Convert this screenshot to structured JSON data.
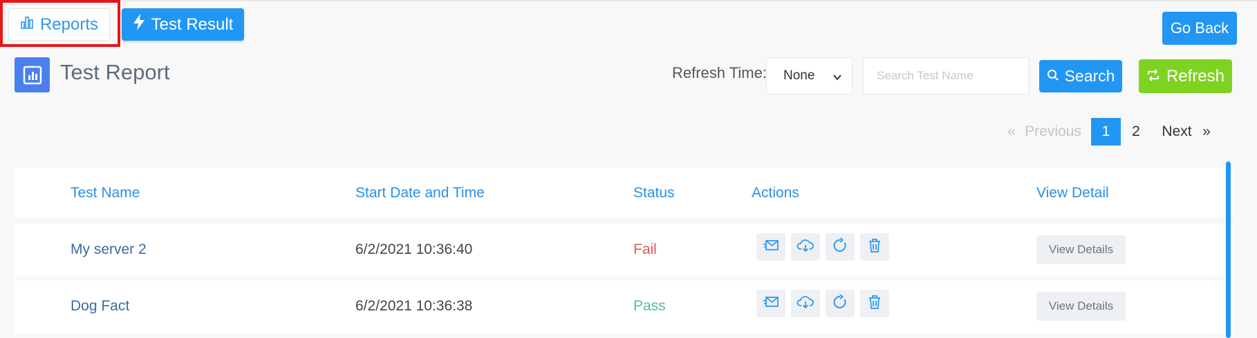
{
  "tabs": [
    {
      "label": "Reports",
      "icon": "bar-chart-icon"
    },
    {
      "label": "Test Result",
      "icon": "lightning-icon"
    }
  ],
  "header": {
    "go_back_label": "Go Back",
    "title": "Test Report",
    "title_icon": "report-chart-icon"
  },
  "toolbar": {
    "refresh_time_label": "Refresh Time:",
    "refresh_time_value": "None",
    "search_placeholder": "Search Test Name",
    "search_label": "Search",
    "refresh_label": "Refresh"
  },
  "pagination": {
    "first": "«",
    "previous": "Previous",
    "pages": [
      "1",
      "2"
    ],
    "current": "1",
    "next": "Next",
    "last": "»"
  },
  "table": {
    "columns": [
      "Test Name",
      "Start Date and Time",
      "Status",
      "Actions",
      "View Detail"
    ],
    "rows": [
      {
        "name": "My server 2",
        "date": "6/2/2021 10:36:40",
        "status": "Fail",
        "view": "View Details"
      },
      {
        "name": "Dog Fact",
        "date": "6/2/2021 10:36:38",
        "status": "Pass",
        "view": "View Details"
      }
    ],
    "actions": [
      "email-icon",
      "cloud-download-icon",
      "rerun-icon",
      "trash-icon"
    ]
  },
  "colors": {
    "primary": "#2196f3",
    "success": "#7ed321",
    "fail": "#e8535f",
    "pass": "#4fc38c",
    "highlight": "#e8141c"
  }
}
